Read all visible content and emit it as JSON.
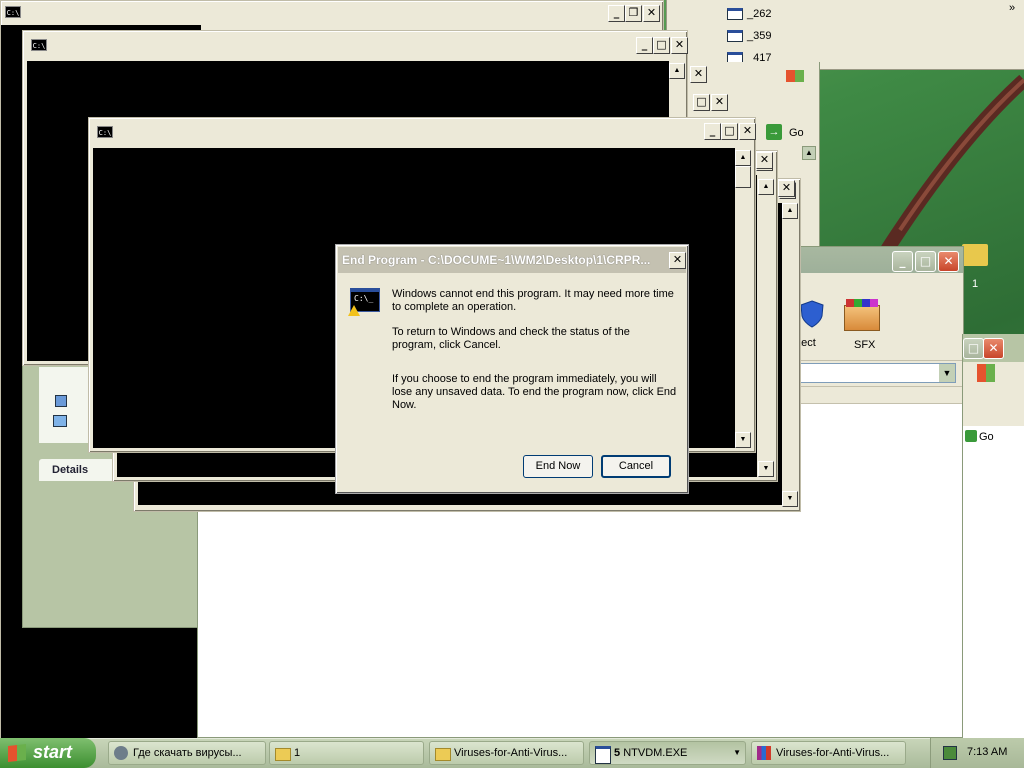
{
  "colors": {
    "accent": "#003c74",
    "taskbar": "#a9ba9a",
    "start": "#3c8f30",
    "xp_close": "#c8452a"
  },
  "top_toolbar_items": [
    "_262",
    "_359",
    "_417"
  ],
  "top_toolbar_chevron": "»",
  "go_labels": [
    "Go",
    "Go"
  ],
  "explorer": {
    "tools": [
      {
        "label": "otect",
        "icon": "shield-icon"
      },
      {
        "label": "SFX",
        "icon": "package-icon"
      }
    ],
    "left_panel_section": "Details"
  },
  "desktop_icon_label": "1",
  "dialog": {
    "title": "End Program - C:\\DOCUME~1\\WM2\\Desktop\\1\\CRPR...",
    "message_1": "Windows cannot end this program. It may need more time to complete an operation.",
    "message_2": "To return to Windows and check the status of the program, click Cancel.",
    "message_3": "If you choose to end the program immediately, you will lose any unsaved data. To end the program now, click End Now.",
    "end_now_label": "End Now",
    "cancel_label": "Cancel",
    "icon_text": "C:\\_"
  },
  "cmd_icon_text": "C:\\",
  "taskbar": {
    "start_label": "start",
    "tasks": [
      {
        "label": "Где скачать вирусы...",
        "icon": "browser-icon"
      },
      {
        "label": "1",
        "icon": "folder-icon"
      },
      {
        "label": "Viruses-for-Anti-Virus...",
        "icon": "folder-icon"
      },
      {
        "label": "NTVDM.EXE",
        "count": "5",
        "icon": "window-icon"
      },
      {
        "label": "Viruses-for-Anti-Virus...",
        "icon": "winrar-icon"
      }
    ],
    "clock": "7:13 AM"
  }
}
